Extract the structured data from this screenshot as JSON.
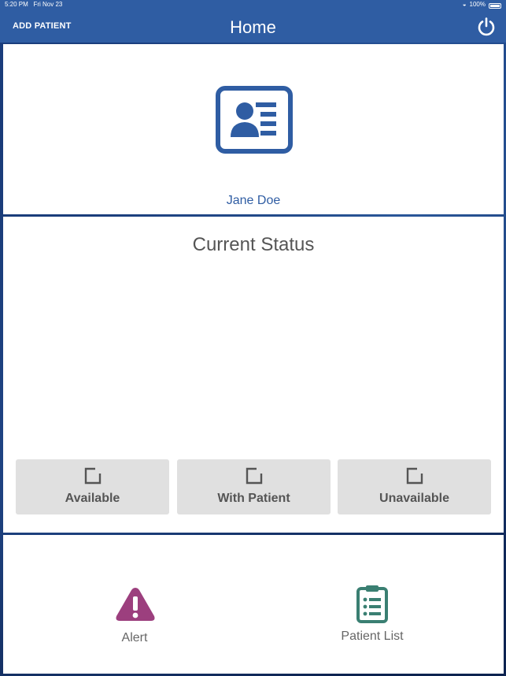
{
  "status_bar": {
    "time": "5:20 PM",
    "date": "Fri Nov 23",
    "battery": "100%"
  },
  "nav": {
    "add_patient": "ADD PATIENT",
    "title": "Home",
    "power_icon": "power-icon"
  },
  "patient": {
    "icon": "id-card-icon",
    "name": "Jane Doe"
  },
  "status": {
    "title": "Current Status",
    "options": [
      {
        "label": "Available",
        "icon": "checkbox-icon"
      },
      {
        "label": "With Patient",
        "icon": "checkbox-icon"
      },
      {
        "label": "Unavailable",
        "icon": "checkbox-icon"
      }
    ]
  },
  "actions": [
    {
      "label": "Alert",
      "icon": "alert-triangle-icon",
      "color": "#9c3f7e"
    },
    {
      "label": "Patient List",
      "icon": "clipboard-list-icon",
      "color": "#3a7f72"
    }
  ],
  "colors": {
    "primary": "#2f5da3",
    "button_bg": "#e0e0e0",
    "text_gray": "#555555"
  }
}
